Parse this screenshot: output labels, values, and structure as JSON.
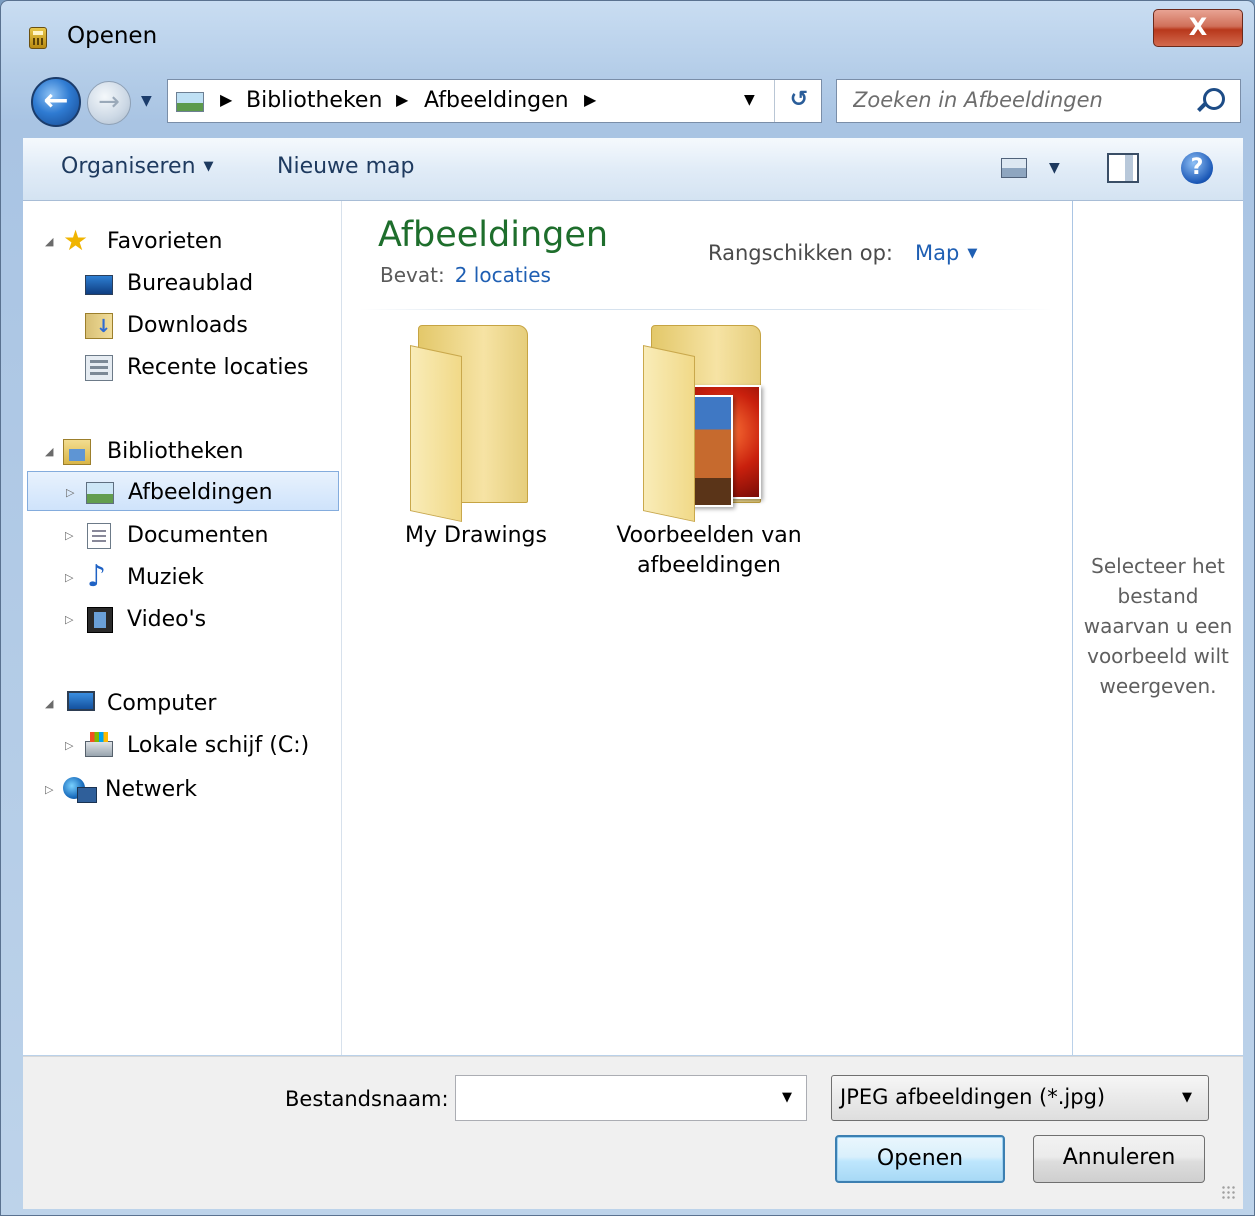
{
  "window": {
    "title": "Openen",
    "close_label": "X"
  },
  "navigation": {
    "breadcrumbs": [
      "Bibliotheken",
      "Afbeeldingen"
    ],
    "search_placeholder": "Zoeken in Afbeeldingen"
  },
  "toolbar": {
    "organize_label": "Organiseren",
    "new_folder_label": "Nieuwe map",
    "help_label": "?"
  },
  "sidebar": {
    "favorites": {
      "label": "Favorieten",
      "items": [
        "Bureaublad",
        "Downloads",
        "Recente locaties"
      ]
    },
    "libraries": {
      "label": "Bibliotheken",
      "items": [
        "Afbeeldingen",
        "Documenten",
        "Muziek",
        "Video's"
      ],
      "selected": "Afbeeldingen"
    },
    "computer": {
      "label": "Computer",
      "items": [
        "Lokale schijf (C:)"
      ]
    },
    "network": {
      "label": "Netwerk"
    }
  },
  "content": {
    "library_title": "Afbeeldingen",
    "contains_label": "Bevat:",
    "contains_link": "2 locaties",
    "arrange_label": "Rangschikken op:",
    "arrange_value": "Map",
    "folders": [
      {
        "name": "My Drawings",
        "name_line2": ""
      },
      {
        "name": "Voorbeelden van",
        "name_line2": "afbeeldingen"
      }
    ]
  },
  "preview_pane": {
    "text": "Selecteer het bestand waarvan u een voorbeeld wilt weergeven."
  },
  "footer": {
    "filename_label": "Bestandsnaam:",
    "filename_value": "",
    "filter_value": "JPEG afbeeldingen (*.jpg)",
    "open_label": "Openen",
    "cancel_label": "Annuleren"
  }
}
